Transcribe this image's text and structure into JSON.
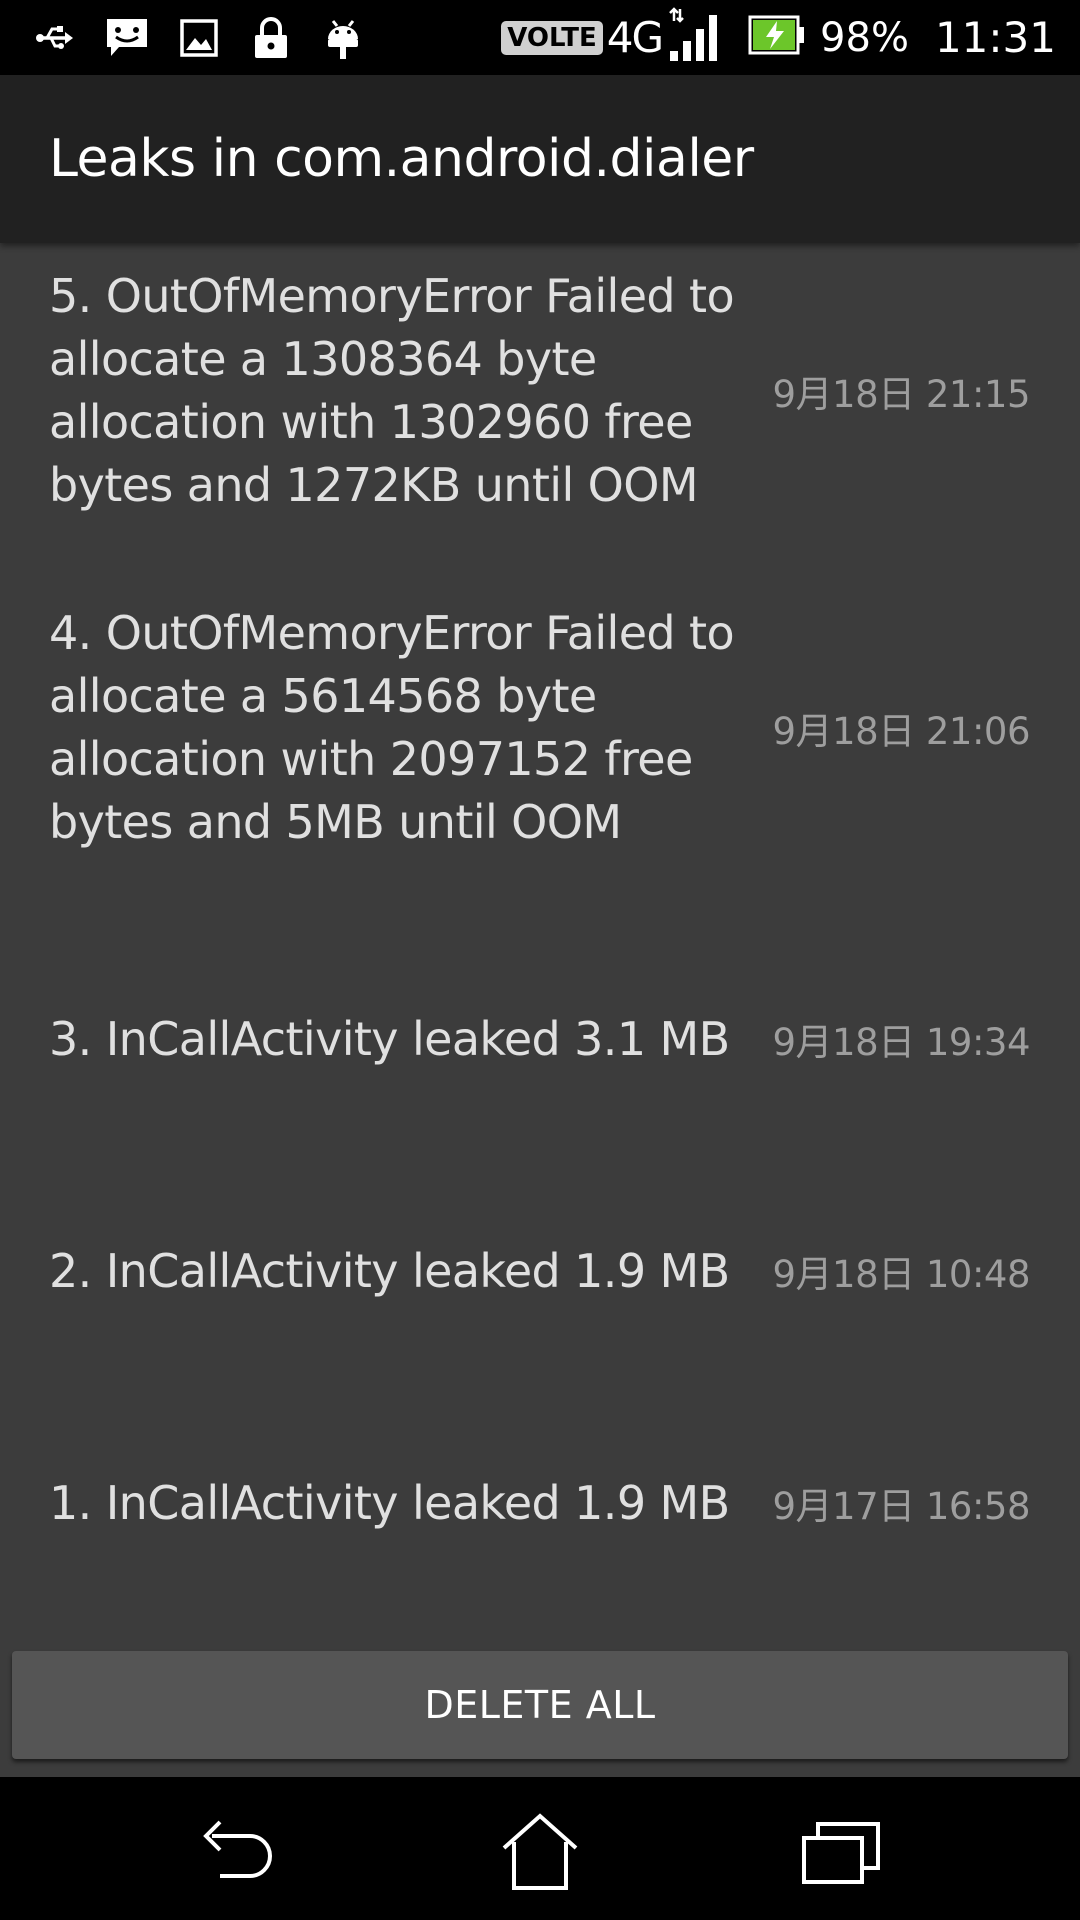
{
  "status_bar": {
    "icons_left": [
      "usb-icon",
      "message-icon",
      "image-icon",
      "lock-icon",
      "android-debug-icon"
    ],
    "volte": "VOLTE",
    "network": "4G",
    "battery_percent": "98%",
    "time": "11:31",
    "colors": {
      "battery_fill": "#6cc62a"
    }
  },
  "app_bar": {
    "title": "Leaks in com.android.dialer"
  },
  "leaks": [
    {
      "title": "5. OutOfMemoryError Failed to allocate a 1308364 byte allocation with 1302960 free bytes and 1272KB until OOM",
      "time": "9月18日 21:15"
    },
    {
      "title": "4. OutOfMemoryError Failed to allocate a 5614568 byte allocation with 2097152 free bytes and 5MB until OOM",
      "time": "9月18日 21:06"
    },
    {
      "title": "3. InCallActivity leaked 3.1 MB",
      "time": "9月18日 19:34"
    },
    {
      "title": "2. InCallActivity leaked 1.9 MB",
      "time": "9月18日 10:48"
    },
    {
      "title": "1. InCallActivity leaked 1.9 MB",
      "time": "9月17日 16:58"
    }
  ],
  "actions": {
    "delete_all_label": "DELETE ALL"
  },
  "nav_bar": {
    "buttons": [
      "back-icon",
      "home-icon",
      "recents-icon"
    ]
  }
}
